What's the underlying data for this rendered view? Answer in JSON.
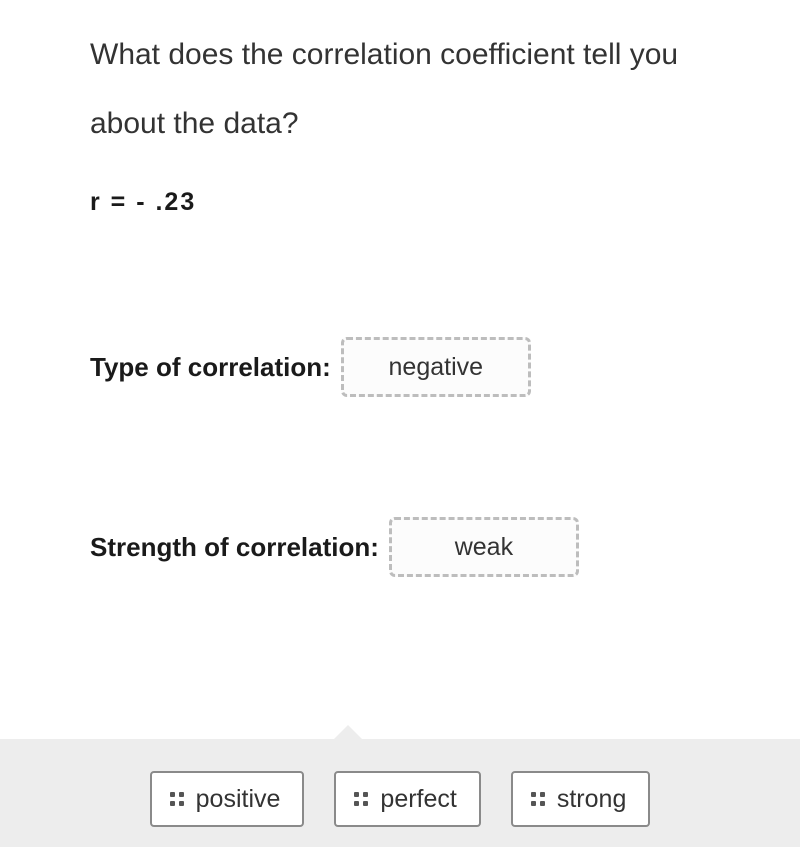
{
  "question": "What does the correlation coefficient tell you about the data?",
  "equation": "r  =  - .23",
  "fields": {
    "type": {
      "label": "Type of correlation:",
      "value": "negative"
    },
    "strength": {
      "label": "Strength of correlation:",
      "value": "weak"
    }
  },
  "choices": [
    "positive",
    "perfect",
    "strong"
  ]
}
